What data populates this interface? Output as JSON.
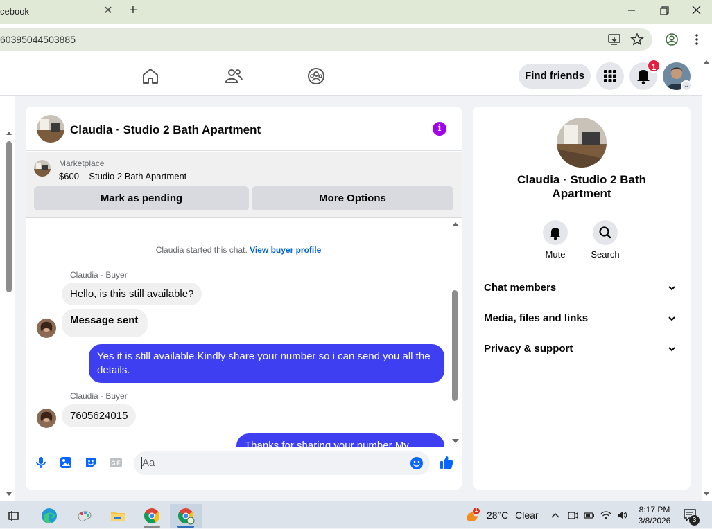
{
  "browser": {
    "tab_title": "cebook",
    "tab_close": "✕",
    "new_tab": "+",
    "url": "60395044503885"
  },
  "fbnav": {
    "find_friends": "Find friends",
    "notification_count": "1"
  },
  "chat": {
    "title": "Claudia · Studio 2 Bath Apartment",
    "marketplace_label": "Marketplace",
    "marketplace_item": "$600 – Studio 2 Bath Apartment",
    "mark_pending": "Mark as pending",
    "more_options": "More Options",
    "system_text": "Claudia started this chat.",
    "system_link": "View buyer profile",
    "messages": [
      {
        "sender": "Claudia · Buyer",
        "text": "Hello, is this still available?"
      },
      {
        "text": "Message sent"
      },
      {
        "text": "Yes it is still available.Kindly share your number so i can send you all the details."
      },
      {
        "sender": "Claudia · Buyer",
        "text": "7605624015"
      },
      {
        "text": "Thanks for sharing your number My"
      }
    ],
    "input_placeholder": "Aa"
  },
  "right_panel": {
    "title": "Claudia · Studio 2 Bath Apartment",
    "mute_label": "Mute",
    "search_label": "Search",
    "sections": [
      "Chat members",
      "Media, files and links",
      "Privacy & support"
    ]
  },
  "taskbar": {
    "temperature": "28°C",
    "weather": "Clear",
    "time": "8:17 PM",
    "date": "3/8/2026",
    "weather_badge": "1",
    "notification_count": "3"
  },
  "colors": {
    "accent_blue": "#3e3ff0",
    "info_purple": "#a200e8",
    "badge_red": "#e41e3f",
    "link_blue": "#0064d1"
  }
}
